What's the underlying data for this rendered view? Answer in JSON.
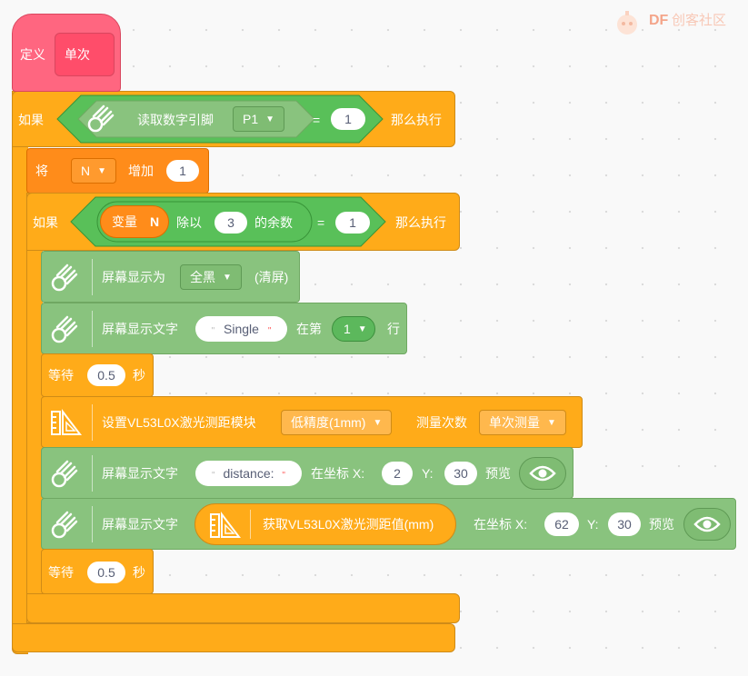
{
  "brand": {
    "df": "DF",
    "cn": "创客社区"
  },
  "define": {
    "label": "定义",
    "name": "单次"
  },
  "if1": {
    "if": "如果",
    "read": "读取数字引脚",
    "pin": "P1",
    "eq": "=",
    "value": "1",
    "then": "那么执行"
  },
  "set": {
    "label": "将",
    "var": "N",
    "op": "增加",
    "value": "1"
  },
  "if2": {
    "if": "如果",
    "var_label": "变量",
    "var": "N",
    "div": "除以",
    "divisor": "3",
    "rem": "的余数",
    "eq": "=",
    "value": "1",
    "then": "那么执行"
  },
  "screen_fill": {
    "label": "屏幕显示为",
    "option": "全黑",
    "suffix": "(清屏)"
  },
  "screen_text1": {
    "label": "屏幕显示文字",
    "text": "Single",
    "at_row": "在第",
    "row": "1",
    "row_suffix": "行"
  },
  "wait1": {
    "label": "等待",
    "value": "0.5",
    "unit": "秒"
  },
  "sensor_set": {
    "label": "设置VL53L0X激光测距模块",
    "precision": "低精度(1mm)",
    "count_label": "测量次数",
    "mode": "单次测量"
  },
  "screen_text2": {
    "label": "屏幕显示文字",
    "text": "distance:",
    "at": "在坐标 X:",
    "x": "2",
    "y_label": "Y:",
    "y": "30",
    "preview": "预览"
  },
  "screen_text3": {
    "label": "屏幕显示文字",
    "reporter": "获取VL53L0X激光测距值(mm)",
    "at": "在坐标 X:",
    "x": "62",
    "y_label": "Y:",
    "y": "30",
    "preview": "预览"
  },
  "wait2": {
    "label": "等待",
    "value": "0.5",
    "unit": "秒"
  },
  "colors": {
    "control": "#ffab19",
    "variable": "#ff8c1a",
    "display": "#89c37e",
    "operator": "#59c059",
    "define": "#ff6680"
  }
}
